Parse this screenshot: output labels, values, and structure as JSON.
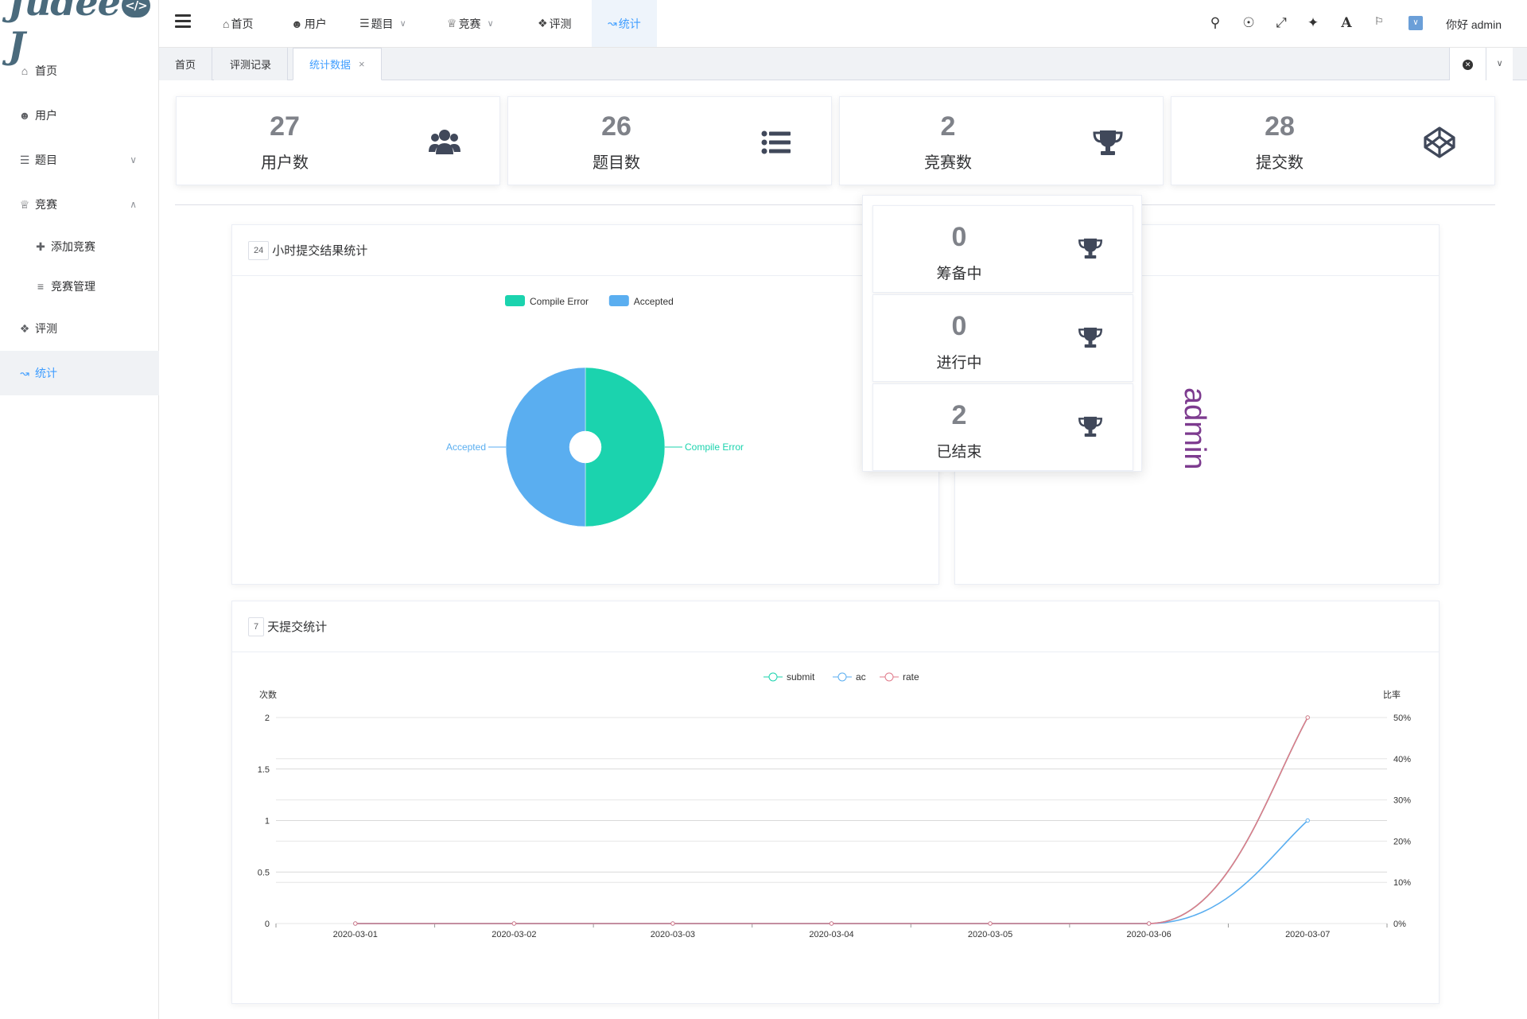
{
  "app": {
    "logo": "Judee",
    "logo_badge": "</>",
    "logo_tail": "J"
  },
  "sidebar": {
    "items": [
      {
        "label": "首页",
        "icon": "home-icon"
      },
      {
        "label": "用户",
        "icon": "user-circle-icon"
      },
      {
        "label": "题目",
        "icon": "list-icon"
      },
      {
        "label": "竞赛",
        "icon": "trophy-icon"
      },
      {
        "label": "添加竞赛",
        "icon": "plus-icon"
      },
      {
        "label": "竞赛管理",
        "icon": "list-ol-icon"
      },
      {
        "label": "评测",
        "icon": "codepen-icon"
      },
      {
        "label": "统计",
        "icon": "chart-line-icon"
      }
    ]
  },
  "topnav": {
    "items": [
      {
        "label": "首页"
      },
      {
        "label": "用户"
      },
      {
        "label": "题目"
      },
      {
        "label": "竞赛"
      },
      {
        "label": "评测"
      },
      {
        "label": "统计"
      }
    ],
    "greeting": "你好 admin"
  },
  "tabs": [
    {
      "label": "首页"
    },
    {
      "label": "评测记录"
    },
    {
      "label": "统计数据"
    }
  ],
  "stats": [
    {
      "value": "27",
      "label": "用户数",
      "icon": "users-icon"
    },
    {
      "value": "26",
      "label": "题目数",
      "icon": "list-icon"
    },
    {
      "value": "2",
      "label": "竞赛数",
      "icon": "trophy-icon"
    },
    {
      "value": "28",
      "label": "提交数",
      "icon": "codepen-icon"
    }
  ],
  "contest_dropdown": [
    {
      "value": "0",
      "label": "筹备中"
    },
    {
      "value": "0",
      "label": "进行中"
    },
    {
      "value": "2",
      "label": "已结束"
    }
  ],
  "panel_24h": {
    "badge": "24",
    "title": "小时提交结果统计"
  },
  "panel_7d": {
    "badge": "7",
    "title": "天提交统计"
  },
  "user_panel": {
    "name": "admin"
  },
  "colors": {
    "accent": "#409eff",
    "compile_error": "#1bd3ae",
    "accepted": "#5aaef0",
    "rate": "#e07a8a"
  },
  "chart_data": [
    {
      "type": "pie",
      "legend": [
        "Compile Error",
        "Accepted"
      ],
      "slices": [
        {
          "name": "Compile Error",
          "value": 1
        },
        {
          "name": "Accepted",
          "value": 1
        }
      ]
    },
    {
      "type": "line",
      "legend": [
        "submit",
        "ac",
        "rate"
      ],
      "x": [
        "2020-03-01",
        "2020-03-02",
        "2020-03-03",
        "2020-03-04",
        "2020-03-05",
        "2020-03-06",
        "2020-03-07"
      ],
      "ylabel": "次数",
      "y2label": "比率",
      "yticks": [
        "0",
        "0.5",
        "1",
        "1.5",
        "2"
      ],
      "y2ticks": [
        "0%",
        "10%",
        "20%",
        "30%",
        "40%",
        "50%"
      ],
      "ylim": [
        0,
        2
      ],
      "y2lim": [
        0,
        50
      ],
      "series": [
        {
          "name": "submit",
          "axis": "left",
          "values": [
            0,
            0,
            0,
            0,
            0,
            0,
            2
          ]
        },
        {
          "name": "ac",
          "axis": "left",
          "values": [
            0,
            0,
            0,
            0,
            0,
            0,
            1
          ]
        },
        {
          "name": "rate",
          "axis": "right",
          "values": [
            0,
            0,
            0,
            0,
            0,
            0,
            50
          ]
        }
      ]
    }
  ]
}
